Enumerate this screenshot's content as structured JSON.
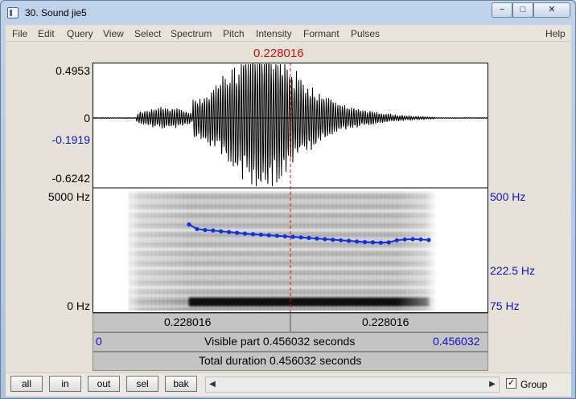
{
  "window": {
    "title": "30. Sound jie5",
    "min_glyph": "−",
    "max_glyph": "□",
    "close_glyph": "✕"
  },
  "menu": [
    "File",
    "Edit",
    "Query",
    "View",
    "Select",
    "Spectrum",
    "Pitch",
    "Intensity",
    "Formant",
    "Pulses",
    "Help"
  ],
  "cursor_time": "0.228016",
  "waveform_axis": {
    "max": "0.4953",
    "zero": "0",
    "cursor_value": "-0.1919",
    "min": "-0.6242"
  },
  "spectrogram_axis": {
    "left_top": "5000 Hz",
    "left_bottom": "0 Hz",
    "right_top": "500 Hz",
    "right_mid": "222.5 Hz",
    "right_bottom": "75 Hz"
  },
  "time_bars": {
    "left_segment": "0.228016",
    "right_segment": "0.228016",
    "visible_start": "0",
    "visible_label": "Visible part 0.456032 seconds",
    "visible_end": "0.456032",
    "total_label": "Total duration 0.456032 seconds"
  },
  "bottom": {
    "buttons": [
      "all",
      "in",
      "out",
      "sel",
      "bak"
    ],
    "scroll_left": "◀",
    "scroll_right": "▶",
    "group_checked": true,
    "group_mark": "✓",
    "group_label": "Group"
  },
  "colors": {
    "cursor": "#d01010",
    "axis_blue": "#1010c0",
    "pitch": "#1030e0"
  },
  "pitch_curve_hz": [
    287,
    268,
    264,
    262,
    259,
    256,
    253,
    250,
    248,
    246,
    244,
    242,
    240,
    238,
    236,
    234,
    232,
    230,
    228,
    226,
    224,
    222,
    220,
    219,
    218,
    219,
    226,
    229,
    230,
    229,
    227
  ]
}
